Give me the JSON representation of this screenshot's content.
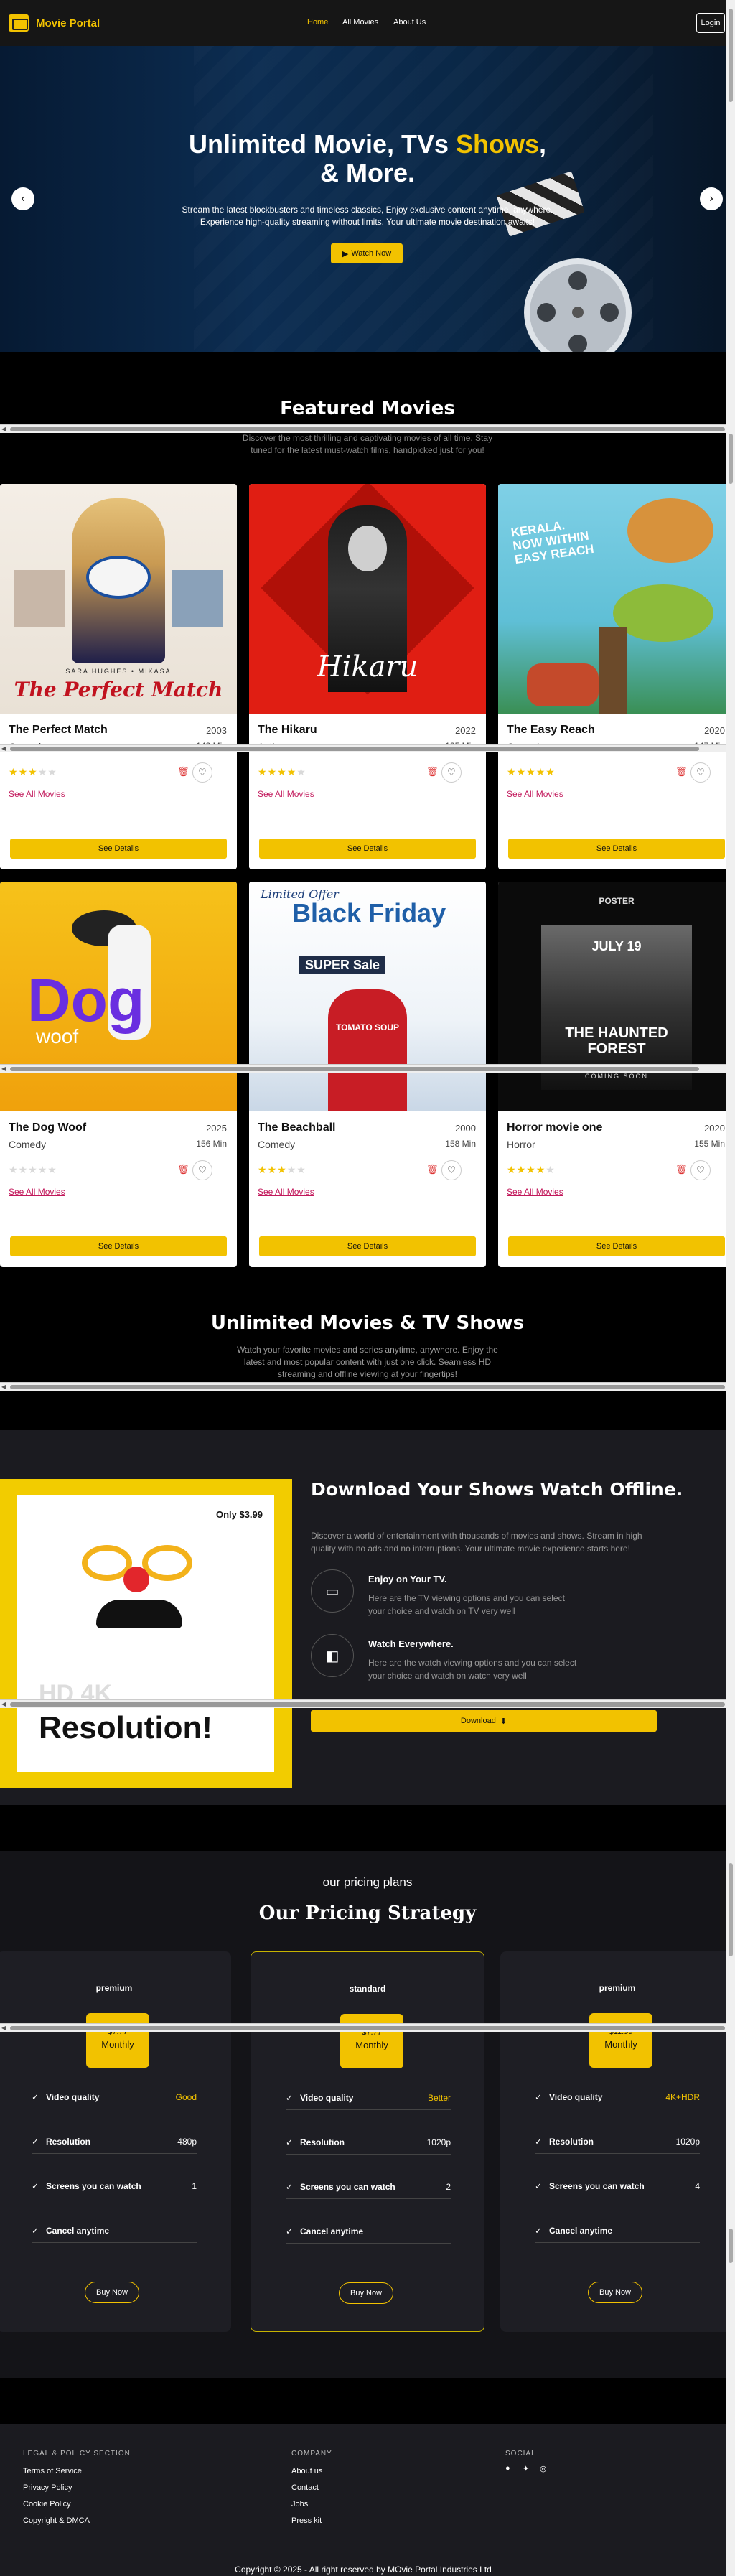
{
  "nav": {
    "brand": "Movie Portal",
    "links": [
      "Home",
      "All Movies",
      "About Us"
    ],
    "login": "Login"
  },
  "hero": {
    "title_1": "Unlimited Movie, TVs ",
    "title_highlight": "Shows",
    "title_2": ",",
    "title_3": "& More.",
    "text": "Stream the latest blockbusters and timeless classics, Enjoy exclusive content anytime, anywhere. Experience high-quality streaming without limits. Your ultimate movie destination awaits!",
    "button": "Watch Now",
    "prev": "‹",
    "next": "›"
  },
  "featured": {
    "title": "Featured Movies",
    "subtitle": "Discover the most thrilling and captivating movies of all time. Stay tuned for the latest must-watch films, handpicked just for you!",
    "see_all": "See All Movies",
    "see_details": "See Details",
    "movies": [
      {
        "title": "The Perfect Match",
        "year": "2003",
        "genre": "Comedy",
        "duration": "143 Min",
        "rating": 3,
        "poster_text": "The Perfect Match",
        "poster_names": "SARA HUGHES • MIKASA"
      },
      {
        "title": "The Hikaru",
        "year": "2022",
        "genre": "Action",
        "duration": "135 Min",
        "rating": 4,
        "poster_text": "Hikaru"
      },
      {
        "title": "The Easy Reach",
        "year": "2020",
        "genre": "Comedy",
        "duration": "147 Min",
        "rating": 5,
        "poster_text": "KERALA. NOW WITHIN EASY REACH"
      },
      {
        "title": "The Dog Woof",
        "year": "2025",
        "genre": "Comedy",
        "duration": "156 Min",
        "rating": 0,
        "poster_text": "Dog",
        "poster_sub": "woof"
      },
      {
        "title": "The Beachball",
        "year": "2000",
        "genre": "Comedy",
        "duration": "158 Min",
        "rating": 3,
        "poster_text_1": "Limited Offer",
        "poster_text_2": "Black Friday",
        "poster_text_3": "SUPER Sale",
        "poster_text_4": "TOMATO SOUP"
      },
      {
        "title": "Horror movie one",
        "year": "2020",
        "genre": "Horror",
        "duration": "155 Min",
        "rating": 4,
        "poster_text_1": "POSTER",
        "poster_text_2": "THE HAUNTED FOREST",
        "poster_text_3": "COMING SOON",
        "poster_text_4": "JULY 19"
      }
    ]
  },
  "unlimited": {
    "title": "Unlimited Movies & TV Shows",
    "subtitle": "Watch your favorite movies and series anytime, anywhere. Enjoy the latest and most popular content with just one click. Seamless HD streaming and offline viewing at your fingertips!"
  },
  "offline": {
    "title": "Download Your Shows Watch Offline.",
    "text": "Discover a world of entertainment with thousands of movies and shows. Stream in high quality with no ads and no interruptions. Your ultimate movie experience starts here!",
    "promo_price": "Only $3.99",
    "promo_hd": "HD 4K",
    "promo_res": "Resolution!",
    "features": [
      {
        "title": "Enjoy on Your TV.",
        "text": "Here are the TV viewing options and you can select your choice and watch on TV very well",
        "icon": "tv-icon"
      },
      {
        "title": "Watch Everywhere.",
        "text": "Here are the watch viewing options and you can select your choice and watch on watch very well",
        "icon": "watch-icon"
      }
    ],
    "download": "Download"
  },
  "pricing": {
    "kicker": "our pricing plans",
    "title": "Our Pricing Strategy",
    "plans": [
      {
        "name": "premium",
        "price": "$7.77",
        "period": "Monthly",
        "quality": "Good",
        "resolution": "480p",
        "screens": "1",
        "buy": "Buy Now"
      },
      {
        "name": "standard",
        "price": "$7.77",
        "period": "Monthly",
        "quality": "Better",
        "resolution": "1020p",
        "screens": "2",
        "buy": "Buy Now"
      },
      {
        "name": "premium",
        "price": "$11.99",
        "period": "Monthly",
        "quality": "4K+HDR",
        "resolution": "1020p",
        "screens": "4",
        "buy": "Buy Now"
      }
    ],
    "labels": {
      "quality": "Video quality",
      "resolution": "Resolution",
      "screens": "Screens you can watch",
      "cancel": "Cancel anytime"
    }
  },
  "footer": {
    "legal_head": "LEGAL & POLICY SECTION",
    "legal": [
      "Terms of Service",
      "Privacy Policy",
      "Cookie Policy",
      "Copyright & DMCA"
    ],
    "company_head": "COMPANY",
    "company": [
      "About us",
      "Contact",
      "Jobs",
      "Press kit"
    ],
    "social_head": "SOCIAL",
    "copyright": "Copyright © 2025 - All right reserved by MOvie Portal Industries Ltd"
  },
  "colors": {
    "accent": "#f2c200",
    "page_bg": "#000000",
    "panel_bg": "#1e1e24",
    "link": "#c2185b"
  }
}
